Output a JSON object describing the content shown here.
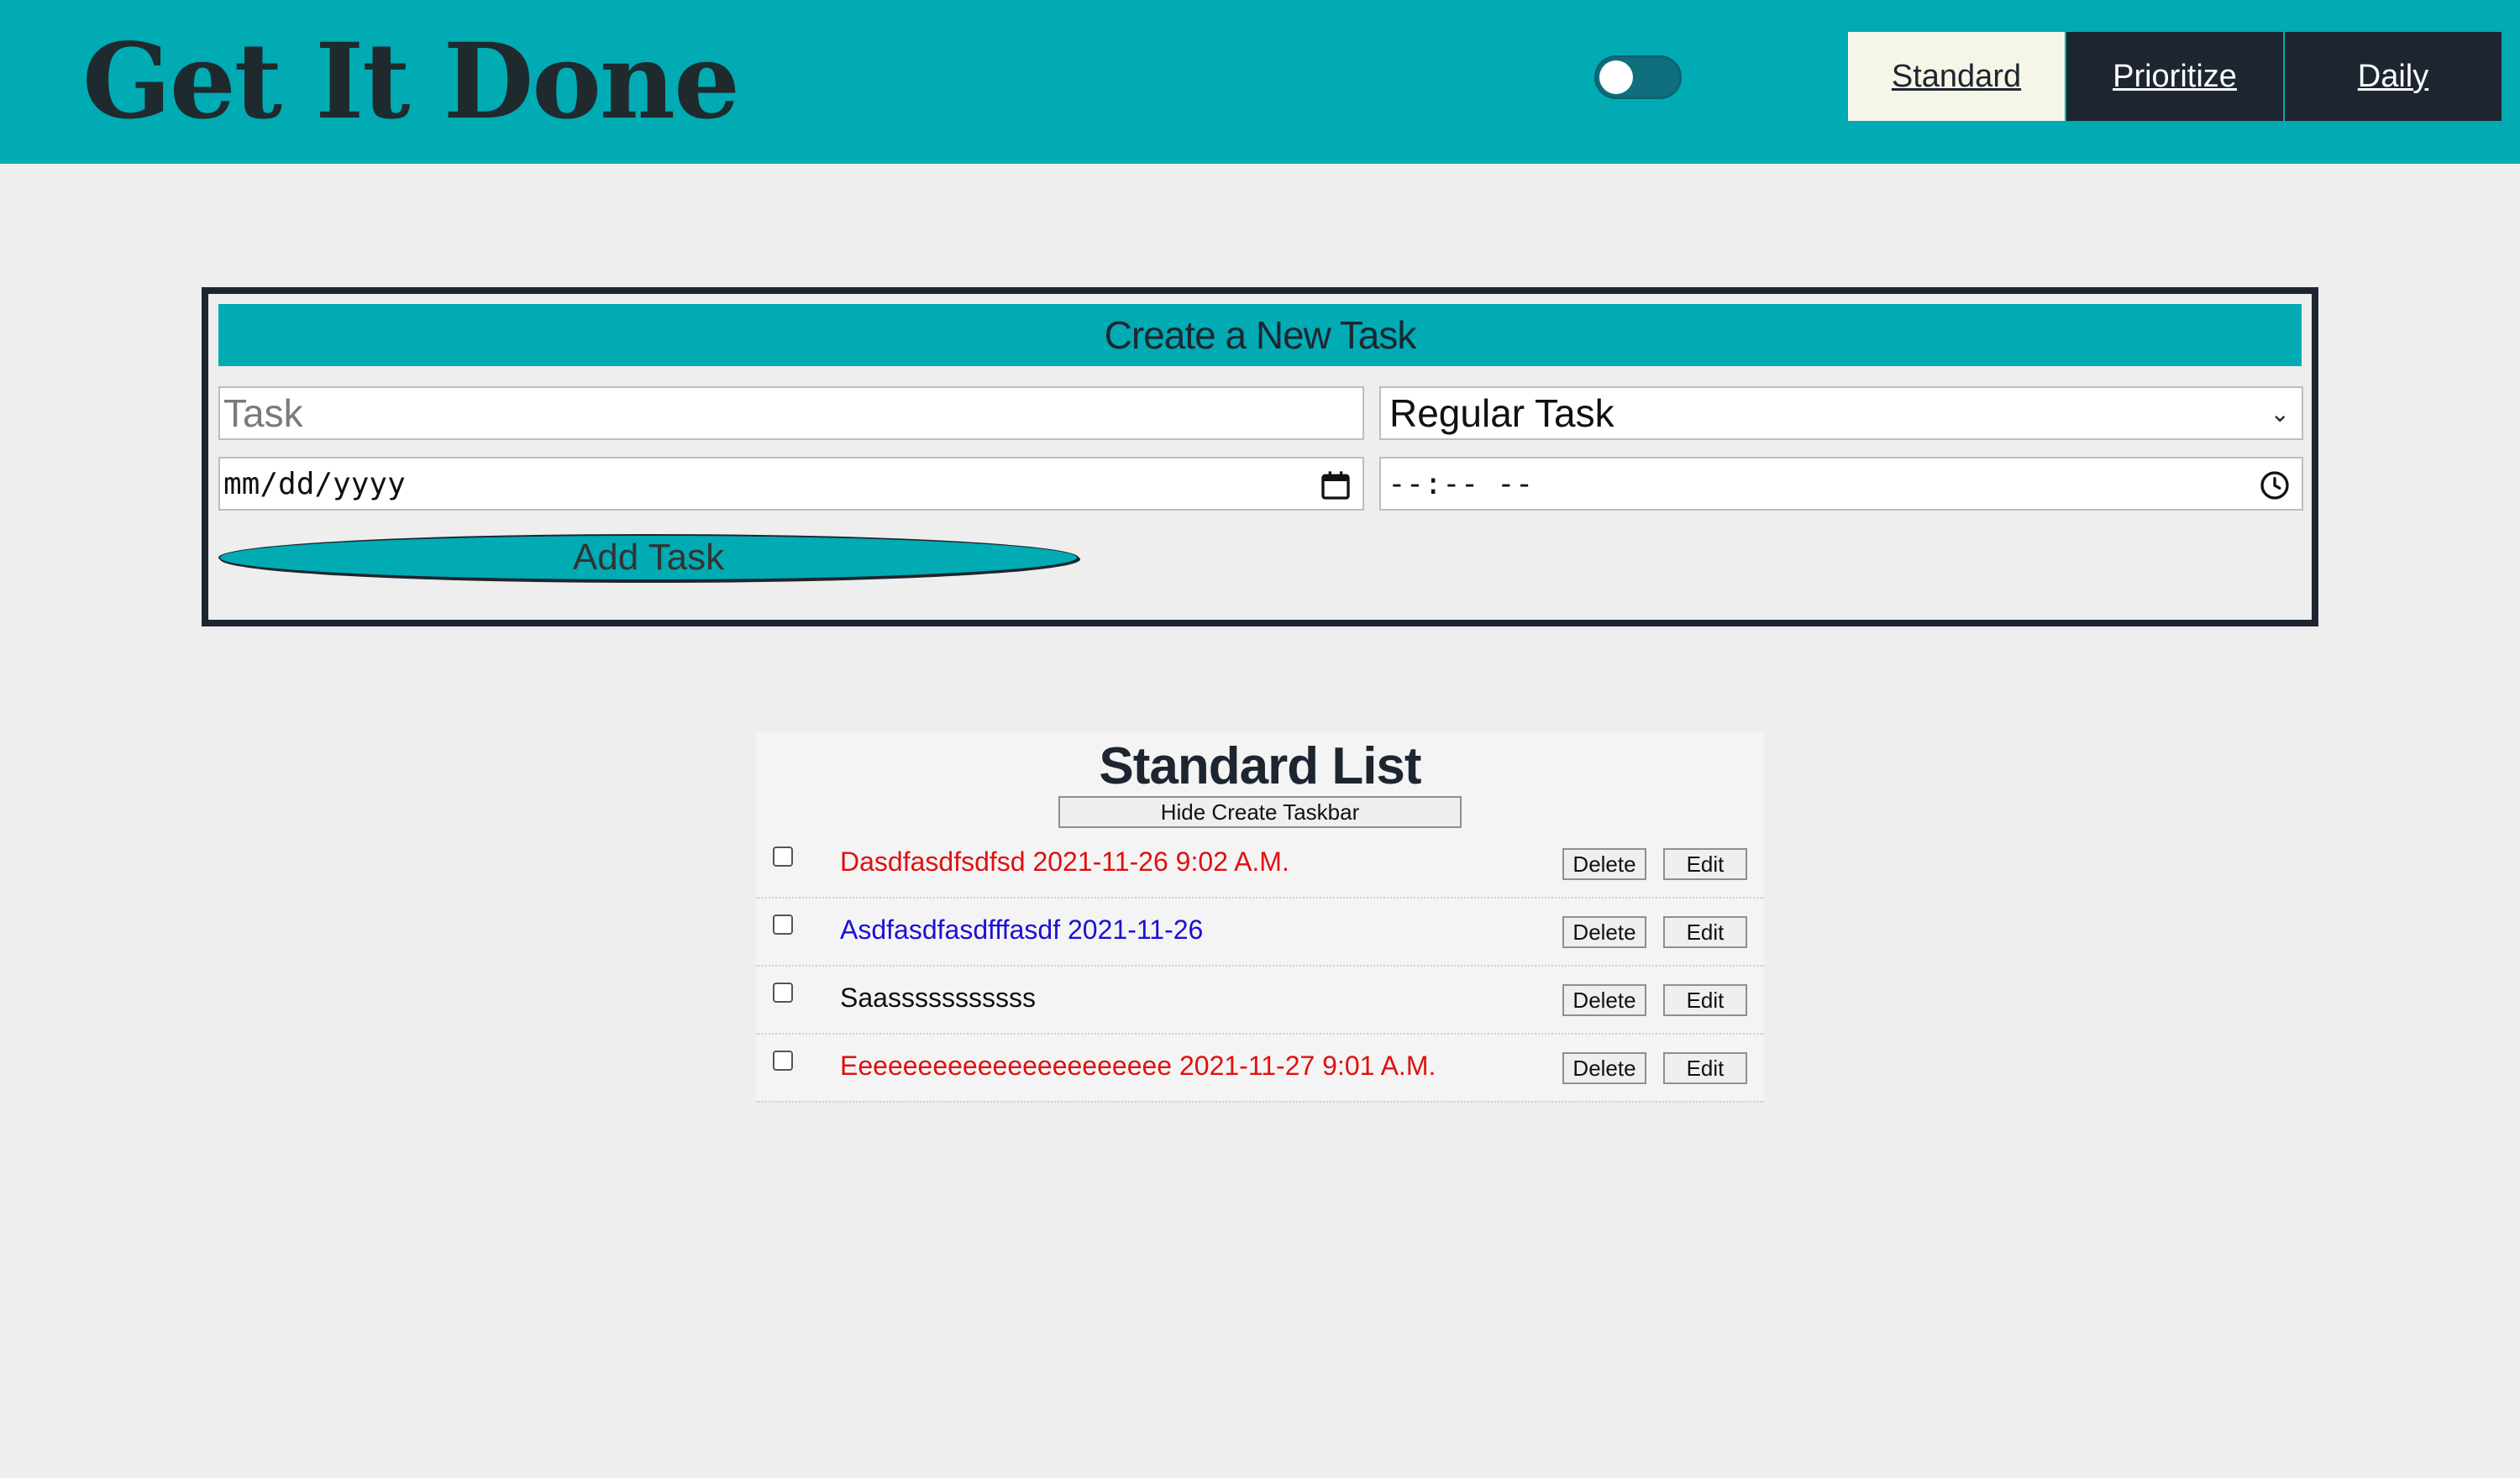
{
  "header": {
    "title": "Get It Done",
    "nav": [
      {
        "label": "Standard",
        "active": true
      },
      {
        "label": "Prioritize",
        "active": false
      },
      {
        "label": "Daily",
        "active": false
      }
    ],
    "theme_toggle": {
      "on": false
    }
  },
  "create_task": {
    "title": "Create a New Task",
    "task_placeholder": "Task",
    "type_value": "Regular Task",
    "date_placeholder": "mm/dd/yyyy",
    "time_placeholder": "--:-- --",
    "add_label": "Add Task"
  },
  "list": {
    "title": "Standard List",
    "hide_label": "Hide Create Taskbar",
    "delete_label": "Delete",
    "edit_label": "Edit",
    "tasks": [
      {
        "text": "Dasdfasdfsdfsd 2021-11-26 9:02 A.M.",
        "color": "red"
      },
      {
        "text": "Asdfasdfasdfffasdf 2021-11-26",
        "color": "blue"
      },
      {
        "text": "Saasssssssssss",
        "color": "black"
      },
      {
        "text": "Eeeeeeeeeeeeeeeeeeeeee 2021-11-27 9:01 A.M.",
        "color": "red"
      }
    ]
  },
  "colors": {
    "accent": "#00abb3",
    "dark": "#1d2630",
    "background": "#eeeeee",
    "high_priority": "#e01010",
    "scheduled": "#1a10d8"
  }
}
